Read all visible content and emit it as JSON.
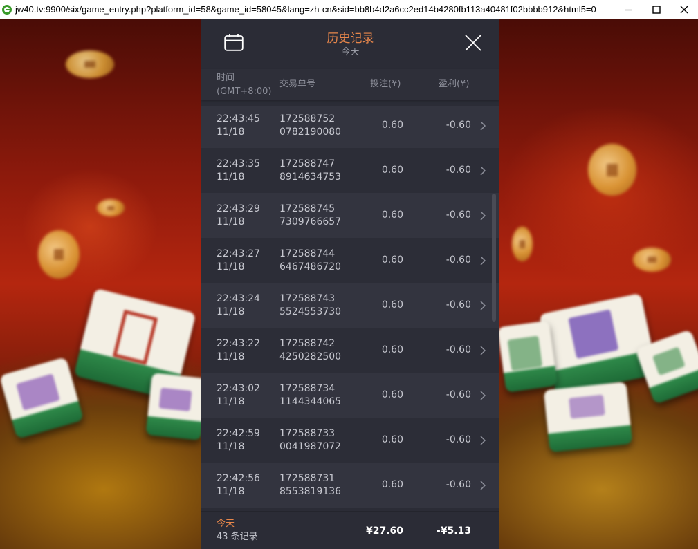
{
  "window": {
    "url": "jw40.tv:9900/six/game_entry.php?platform_id=58&game_id=58045&lang=zh-cn&sid=bb8b4d2a6cc2ed14b4280fb113a40481f02bbbb912&html5=0"
  },
  "header": {
    "title": "历史记录",
    "subtitle": "今天",
    "calendar_icon": "calendar-icon",
    "close_icon": "close-icon"
  },
  "columns": {
    "time_line1": "时间",
    "time_line2": "(GMT+8:00)",
    "order": "交易单号",
    "bet": "投注(¥)",
    "profit": "盈利(¥)"
  },
  "records": [
    {
      "time": "22:43:45",
      "date": "11/18",
      "order1": "172588752",
      "order2": "0782190080",
      "bet": "0.60",
      "profit": "-0.60"
    },
    {
      "time": "22:43:35",
      "date": "11/18",
      "order1": "172588747",
      "order2": "8914634753",
      "bet": "0.60",
      "profit": "-0.60"
    },
    {
      "time": "22:43:29",
      "date": "11/18",
      "order1": "172588745",
      "order2": "7309766657",
      "bet": "0.60",
      "profit": "-0.60"
    },
    {
      "time": "22:43:27",
      "date": "11/18",
      "order1": "172588744",
      "order2": "6467486720",
      "bet": "0.60",
      "profit": "-0.60"
    },
    {
      "time": "22:43:24",
      "date": "11/18",
      "order1": "172588743",
      "order2": "5524553730",
      "bet": "0.60",
      "profit": "-0.60"
    },
    {
      "time": "22:43:22",
      "date": "11/18",
      "order1": "172588742",
      "order2": "4250282500",
      "bet": "0.60",
      "profit": "-0.60"
    },
    {
      "time": "22:43:02",
      "date": "11/18",
      "order1": "172588734",
      "order2": "1144344065",
      "bet": "0.60",
      "profit": "-0.60"
    },
    {
      "time": "22:42:59",
      "date": "11/18",
      "order1": "172588733",
      "order2": "0041987072",
      "bet": "0.60",
      "profit": "-0.60"
    },
    {
      "time": "22:42:56",
      "date": "11/18",
      "order1": "172588731",
      "order2": "8553819136",
      "bet": "0.60",
      "profit": "-0.60"
    }
  ],
  "footer": {
    "period": "今天",
    "count": "43 条记录",
    "total_bet": "¥27.60",
    "total_profit": "-¥5.13"
  },
  "colors": {
    "accent": "#e8874b",
    "panel_bg": "#2b2c36",
    "row_alt_bg": "#33343f",
    "text": "#c6c7cf"
  }
}
